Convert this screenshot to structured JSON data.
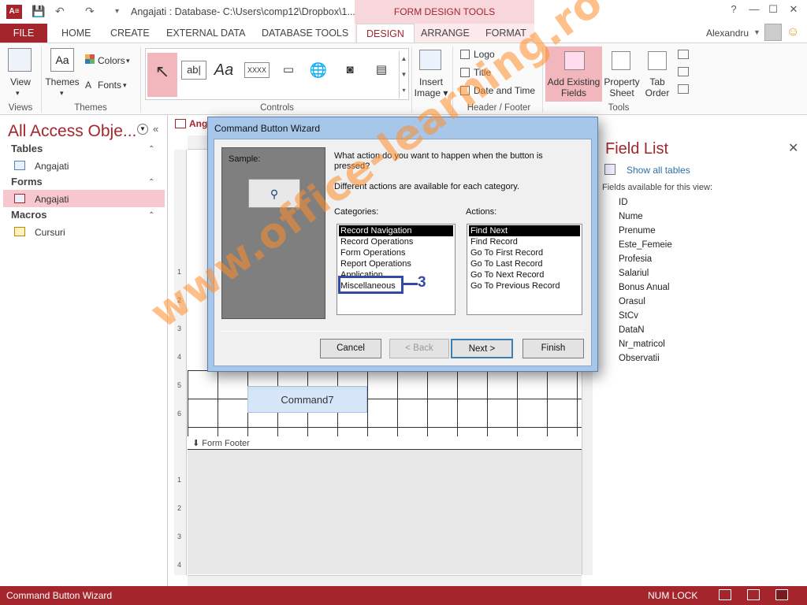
{
  "window": {
    "title": "Angajati : Database- C:\\Users\\comp12\\Dropbox\\1...",
    "context_tools": "FORM DESIGN TOOLS",
    "app_icon": "A≡"
  },
  "tabs": [
    "FILE",
    "HOME",
    "CREATE",
    "EXTERNAL DATA",
    "DATABASE TOOLS",
    "DESIGN",
    "ARRANGE",
    "FORMAT"
  ],
  "user": {
    "name": "Alexandru"
  },
  "ribbon": {
    "views": {
      "view_label": "View",
      "group": "Views"
    },
    "themes": {
      "themes_label": "Themes",
      "colors_label": "Colors",
      "fonts_label": "Fonts",
      "group": "Themes"
    },
    "controls": {
      "group": "Controls",
      "textbox_icon": "ab|",
      "label_icon": "Aa",
      "button_icon": "XXXX"
    },
    "insert_image": {
      "line1": "Insert",
      "line2": "Image"
    },
    "header_footer": {
      "logo": "Logo",
      "title": "Title",
      "date_time": "Date and Time",
      "group": "Header / Footer"
    },
    "tools": {
      "add_existing_1": "Add Existing",
      "add_existing_2": "Fields",
      "property_1": "Property",
      "property_2": "Sheet",
      "tab_order_1": "Tab",
      "tab_order_2": "Order",
      "group": "Tools"
    }
  },
  "nav": {
    "title": "All Access Obje...",
    "sections": [
      {
        "header": "Tables",
        "items": [
          "Angajati"
        ]
      },
      {
        "header": "Forms",
        "items": [
          "Angajati"
        ]
      },
      {
        "header": "Macros",
        "items": [
          "Cursuri"
        ]
      }
    ]
  },
  "design": {
    "doc_tab": "Ang",
    "ruler_numbers": [
      "1",
      "2",
      "3",
      "4",
      "5",
      "6",
      "1",
      "2",
      "3",
      "4"
    ],
    "form_footer": "Form Footer",
    "command_button": "Command7"
  },
  "field_list": {
    "title": "Field List",
    "show_all": "Show all tables",
    "available": "Fields available for this view:",
    "fields": [
      "ID",
      "Nume",
      "Prenume",
      "Este_Femeie",
      "Profesia",
      "Salariul",
      "Bonus Anual",
      "Orasul",
      "StCv",
      "DataN",
      "Nr_matricol",
      "Observatii"
    ]
  },
  "dialog": {
    "title": "Command Button Wizard",
    "sample_label": "Sample:",
    "question": "What action do you want to happen when the button is pressed?",
    "hint": "Different actions are available for each category.",
    "categories_label": "Categories:",
    "actions_label": "Actions:",
    "categories": [
      "Record Navigation",
      "Record Operations",
      "Form Operations",
      "Report Operations",
      "Application",
      "Miscellaneous"
    ],
    "selected_category": "Record Navigation",
    "actions": [
      "Find Next",
      "Find Record",
      "Go To First Record",
      "Go To Last Record",
      "Go To Next Record",
      "Go To Previous Record"
    ],
    "selected_action": "Find Next",
    "annotation_number": "3",
    "buttons": {
      "cancel": "Cancel",
      "back": "< Back",
      "next": "Next >",
      "finish": "Finish"
    }
  },
  "watermark": "www.office-learning.ro",
  "statusbar": {
    "left": "Command Button Wizard",
    "numlock": "NUM LOCK"
  },
  "colors": {
    "accent": "#a4262c",
    "annotation": "#3549a8",
    "watermark": "#ff8c28"
  }
}
